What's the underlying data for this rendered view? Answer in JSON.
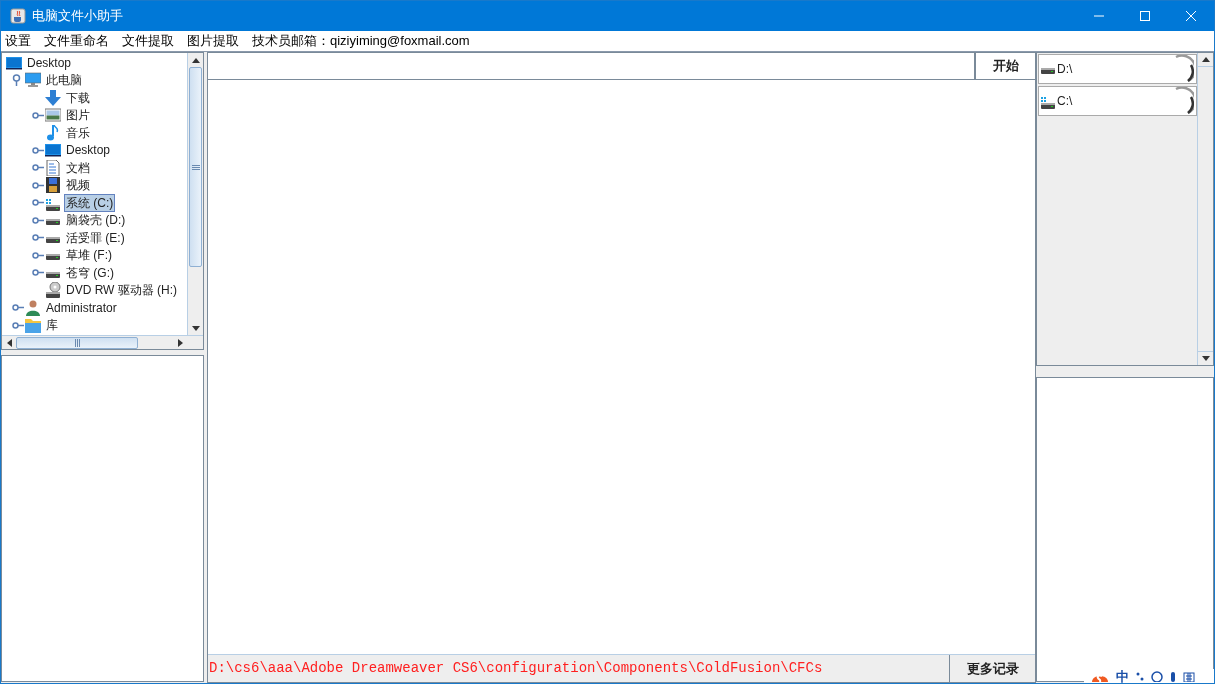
{
  "window": {
    "title": "电脑文件小助手"
  },
  "menu": [
    "设置",
    "文件重命名",
    "文件提取",
    "图片提取",
    "技术员邮箱：qiziyiming@foxmail.com"
  ],
  "tree": [
    {
      "label": "Desktop",
      "kind": "desktop",
      "expandable": false,
      "selected": false,
      "children": [
        {
          "label": "此电脑",
          "kind": "computer",
          "expandable": true,
          "expanded": true,
          "selected": false,
          "children": [
            {
              "label": "下载",
              "kind": "download",
              "expandable": false,
              "selected": false
            },
            {
              "label": "图片",
              "kind": "picture",
              "expandable": true,
              "expanded": false,
              "selected": false
            },
            {
              "label": "音乐",
              "kind": "music",
              "expandable": false,
              "selected": false
            },
            {
              "label": "Desktop",
              "kind": "desktop",
              "expandable": true,
              "expanded": false,
              "selected": false
            },
            {
              "label": "文档",
              "kind": "document",
              "expandable": true,
              "expanded": false,
              "selected": false
            },
            {
              "label": "视频",
              "kind": "video",
              "expandable": true,
              "expanded": false,
              "selected": false
            },
            {
              "label": "系统 (C:)",
              "kind": "system-drive",
              "expandable": true,
              "expanded": false,
              "selected": true
            },
            {
              "label": "脑袋壳 (D:)",
              "kind": "drive",
              "expandable": true,
              "expanded": false,
              "selected": false
            },
            {
              "label": "活受罪 (E:)",
              "kind": "drive",
              "expandable": true,
              "expanded": false,
              "selected": false
            },
            {
              "label": "草堆 (F:)",
              "kind": "drive",
              "expandable": true,
              "expanded": false,
              "selected": false
            },
            {
              "label": "苍穹 (G:)",
              "kind": "drive",
              "expandable": true,
              "expanded": false,
              "selected": false
            },
            {
              "label": "DVD RW 驱动器 (H:)",
              "kind": "dvd",
              "expandable": false,
              "selected": false
            }
          ]
        },
        {
          "label": "Administrator",
          "kind": "user",
          "expandable": true,
          "expanded": false,
          "selected": false
        },
        {
          "label": "库",
          "kind": "folder",
          "expandable": true,
          "expanded": false,
          "selected": false
        }
      ]
    }
  ],
  "start_button": "开始",
  "drives": [
    {
      "label": "D:\\",
      "kind": "drive"
    },
    {
      "label": "C:\\",
      "kind": "system-drive"
    }
  ],
  "status_path": "D:\\cs6\\aaa\\Adobe Dreamweaver CS6\\configuration\\Components\\ColdFusion\\CFCs",
  "more_button": "更多记录",
  "ime_bar": {
    "label": "中"
  }
}
